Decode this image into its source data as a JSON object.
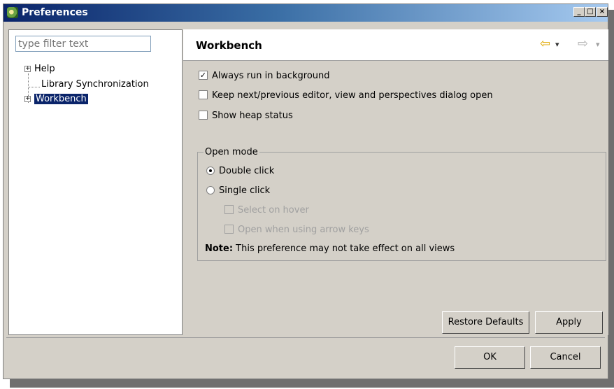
{
  "window": {
    "title": "Preferences",
    "minimize": "_",
    "maximize": "□",
    "close": "×"
  },
  "sidebar": {
    "filter_placeholder": "type filter text",
    "items": [
      {
        "label": "Help",
        "expander": "+"
      },
      {
        "label": "Library Synchronization"
      },
      {
        "label": "Workbench",
        "expander": "+"
      }
    ]
  },
  "page": {
    "title": "Workbench",
    "back_icon": "⇦",
    "back_dropdown": "▾",
    "forward_icon": "⇨",
    "forward_dropdown": "▾",
    "options": [
      {
        "label": "Always run in background",
        "checked": true
      },
      {
        "label": "Keep next/previous editor, view and perspectives dialog open",
        "checked": false
      },
      {
        "label": "Show heap status",
        "checked": false
      }
    ],
    "open_mode": {
      "label": "Open mode",
      "double_click": "Double click",
      "single_click": "Single click",
      "select_on_hover": "Select on hover",
      "open_arrow_keys": "Open when using arrow keys",
      "note_label": "Note:",
      "note_text": " This preference may not take effect on all views"
    },
    "restore_defaults": "Restore Defaults",
    "apply": "Apply"
  },
  "footer": {
    "ok": "OK",
    "cancel": "Cancel"
  },
  "check_mark": "✓"
}
